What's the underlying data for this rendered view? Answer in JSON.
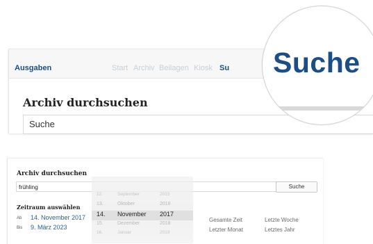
{
  "top_panel": {
    "brand": "Ausgaben",
    "nav_items": [
      "Start",
      "Archiv",
      "Beilagen",
      "Kiosk",
      "Su"
    ],
    "heading": "Archiv durchsuchen",
    "search": {
      "value": "Suche"
    }
  },
  "magnifier": {
    "label": "Suche"
  },
  "bottom_panel": {
    "heading": "Archiv durchsuchen",
    "search": {
      "value": "frühling"
    },
    "search_button": "Suche",
    "range_title": "Zeitraum auswählen",
    "from_label": "Ab",
    "from_value": "14. November 2017",
    "to_label": "Bis",
    "to_value": "9. März 2023",
    "quick_ranges": [
      "Gesamte Zeit",
      "Letzte Woche",
      "Letzter Monat",
      "Letztes Jahr"
    ],
    "date_picker": {
      "rows": [
        {
          "day": "",
          "month": "",
          "year": "",
          "state": "dim"
        },
        {
          "day": "12.",
          "month": "September",
          "year": "2015",
          "state": "dim"
        },
        {
          "day": "13.",
          "month": "Oktober",
          "year": "2016",
          "state": "mid"
        },
        {
          "day": "14.",
          "month": "November",
          "year": "2017",
          "state": "sel"
        },
        {
          "day": "15.",
          "month": "Dezember",
          "year": "2018",
          "state": "mid"
        },
        {
          "day": "16.",
          "month": "Januar",
          "year": "2019",
          "state": "dim"
        }
      ]
    }
  },
  "colors": {
    "brand_blue": "#1b4e86",
    "link_blue": "#2b5f9e",
    "muted_nav": "#c6cfd9"
  }
}
